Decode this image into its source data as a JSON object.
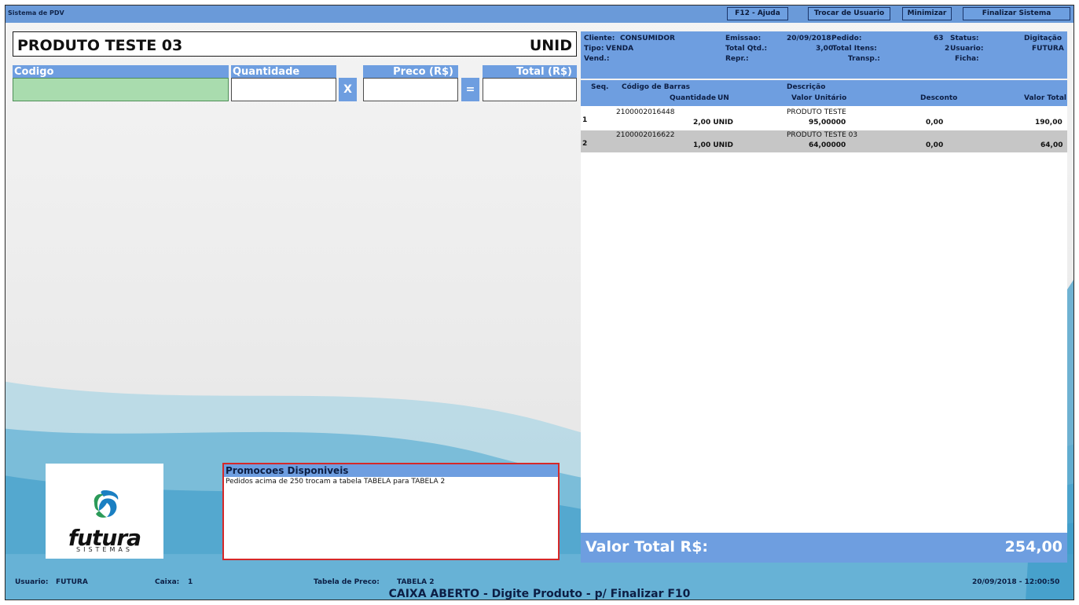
{
  "window": {
    "title": "Sistema de PDV",
    "buttons": [
      "F12 - Ajuda",
      "Trocar de Usuario",
      "Minimizar",
      "Finalizar Sistema"
    ]
  },
  "product": {
    "name": "PRODUTO TESTE 03",
    "unit": "UNID"
  },
  "entry": {
    "codigo_label": "Codigo",
    "quantidade_label": "Quantidade",
    "preco_label": "Preco (R$)",
    "total_label": "Total (R$)",
    "codigo_value": "",
    "quantidade_value": "",
    "preco_value": "",
    "total_value": "",
    "times_symbol": "X",
    "equals_symbol": "="
  },
  "info": {
    "cliente_label": "Cliente:",
    "cliente_value": "CONSUMIDOR",
    "tipo_label": "Tipo:",
    "tipo_value": "VENDA",
    "vend_label": "Vend.:",
    "emissao_label": "Emissao:",
    "emissao_value": "20/09/2018",
    "totalqtd_label": "Total Qtd.:",
    "totalqtd_value": "3,00",
    "repr_label": "Repr.:",
    "pedido_label": "Pedido:",
    "pedido_value": "63",
    "totalitens_label": "Total Itens:",
    "totalitens_value": "2",
    "transp_label": "Transp.:",
    "status_label": "Status:",
    "status_value": "Digitação",
    "usuario_label": "Usuario:",
    "usuario_value": "FUTURA",
    "ficha_label": "Ficha:"
  },
  "table": {
    "headers": {
      "seq": "Seq.",
      "barcode": "Código de Barras",
      "descricao": "Descrição",
      "quantidade": "Quantidade",
      "un": "UN",
      "valor_unitario": "Valor Unitário",
      "desconto": "Desconto",
      "valor_total": "Valor Total"
    },
    "rows": [
      {
        "seq": "1",
        "barcode": "2100002016448",
        "descricao": "PRODUTO TESTE",
        "quantidade": "2,00 UNID",
        "valor_unitario": "95,00000",
        "desconto": "0,00",
        "valor_total": "190,00"
      },
      {
        "seq": "2",
        "barcode": "2100002016622",
        "descricao": "PRODUTO TESTE 03",
        "quantidade": "1,00 UNID",
        "valor_unitario": "64,00000",
        "desconto": "0,00",
        "valor_total": "64,00"
      }
    ]
  },
  "total": {
    "label": "Valor Total R$:",
    "value": "254,00"
  },
  "logo": {
    "word": "futura",
    "sub": "SISTEMAS"
  },
  "promo": {
    "title": "Promocoes Disponiveis",
    "text": "Pedidos acima de 250 trocam a tabela TABELA para TABELA 2"
  },
  "statusbar": {
    "usuario_label": "Usuario:",
    "usuario_value": "FUTURA",
    "caixa_label": "Caixa:",
    "caixa_value": "1",
    "tabela_label": "Tabela de Preco:",
    "tabela_value": "TABELA 2",
    "datetime": "20/09/2018 - 12:00:50",
    "message": "CAIXA ABERTO - Digite Produto - p/ Finalizar F10"
  },
  "colors": {
    "accent": "#6e9ee0",
    "promo_border": "#d62828",
    "codigo_field": "#a9dcae"
  }
}
